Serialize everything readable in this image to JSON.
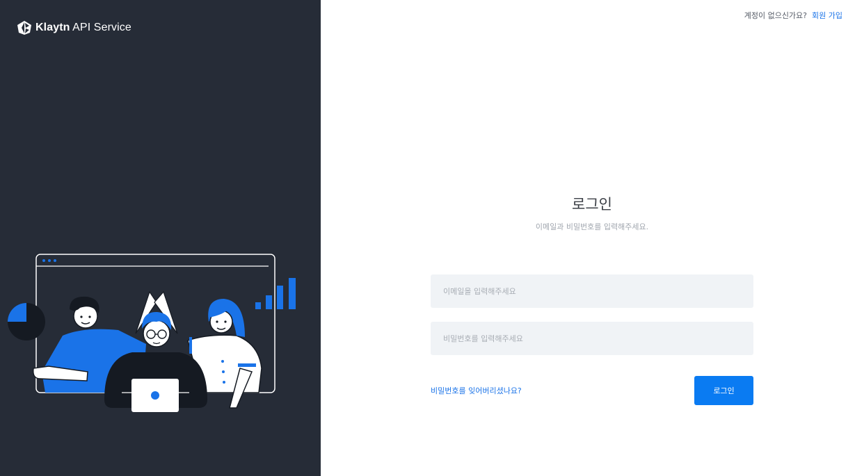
{
  "brand": {
    "name_bold": "Klaytn",
    "name_rest": " API Service"
  },
  "header": {
    "signup_question": "계정이 없으신가요?",
    "signup_link": "회원 가입"
  },
  "login": {
    "title": "로그인",
    "subtitle": "이메일과 비밀번호를 입력해주세요.",
    "email_placeholder": "이메일을 입력해주세요",
    "password_placeholder": "비밀번호를 입력해주세요",
    "forgot_password": "비밀번호를 잊어버리셨나요?",
    "submit_label": "로그인"
  },
  "colors": {
    "sidebar_bg": "#262c37",
    "accent": "#0a7bf2",
    "link": "#1a73e8",
    "input_bg": "#f0f3f6"
  }
}
